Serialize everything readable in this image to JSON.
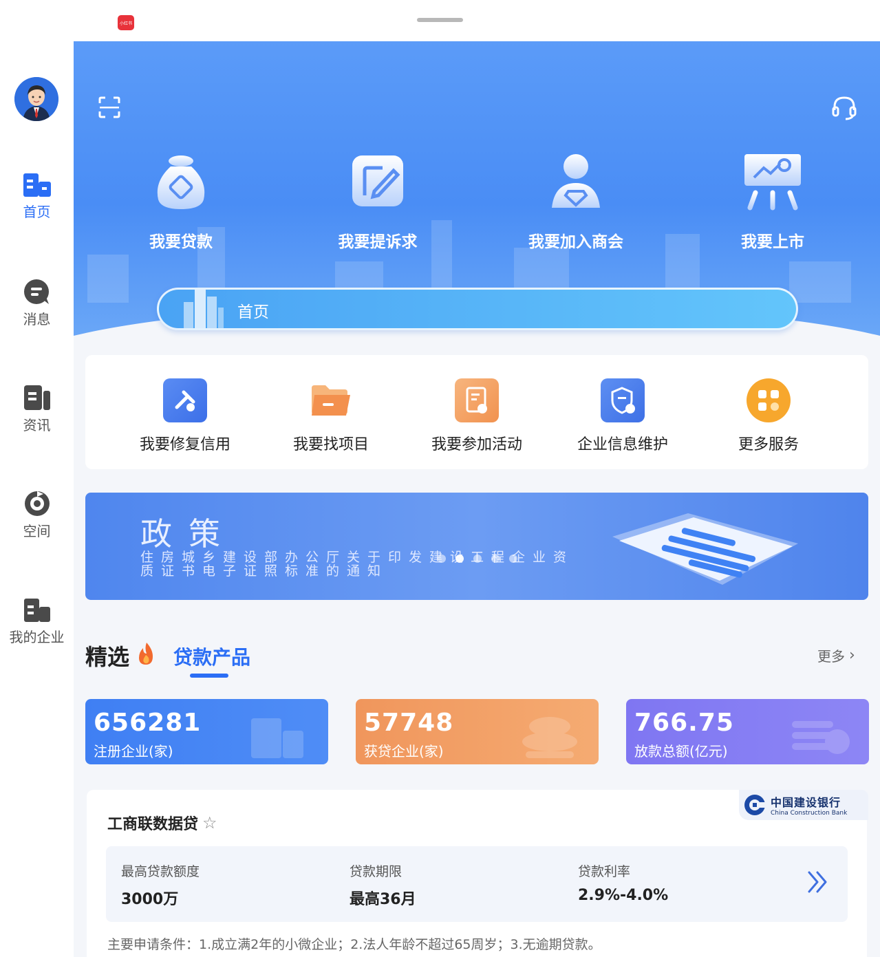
{
  "topbar": {
    "app_badge": "小红书"
  },
  "sidebar": {
    "items": [
      {
        "label": "首页",
        "icon": "home-building-icon",
        "active": true
      },
      {
        "label": "消息",
        "icon": "message-icon",
        "active": false
      },
      {
        "label": "资讯",
        "icon": "news-icon",
        "active": false
      },
      {
        "label": "空间",
        "icon": "space-icon",
        "active": false
      },
      {
        "label": "我的企业",
        "icon": "company-icon",
        "active": false
      }
    ]
  },
  "hero": {
    "quick_actions": [
      {
        "label": "我要贷款",
        "icon": "money-bag-icon"
      },
      {
        "label": "我要提诉求",
        "icon": "edit-note-icon"
      },
      {
        "label": "我要加入商会",
        "icon": "member-icon"
      },
      {
        "label": "我要上市",
        "icon": "presentation-board-icon"
      }
    ],
    "tab_label": "首页"
  },
  "services": [
    {
      "label": "我要修复信用",
      "icon": "repair-tools-icon",
      "color": "#4f7ff0"
    },
    {
      "label": "我要找项目",
      "icon": "folder-icon",
      "color": "#f39a5a"
    },
    {
      "label": "我要参加活动",
      "icon": "activity-doc-icon",
      "color": "#f4a46a"
    },
    {
      "label": "企业信息维护",
      "icon": "shield-company-icon",
      "color": "#4f84ee"
    },
    {
      "label": "更多服务",
      "icon": "grid-apps-icon",
      "color": "#f7a72d"
    }
  ],
  "banner": {
    "title": "政策",
    "subtitle": "住房城乡建设部办公厅关于印发建设工程企业资质证书电子证照标准的通知"
  },
  "featured": {
    "title": "精选",
    "tab": "贷款产品",
    "more": "更多"
  },
  "stats": [
    {
      "value": "656281",
      "caption": "注册企业(家)",
      "color": "#3f7ff3"
    },
    {
      "value": "57748",
      "caption": "获贷企业(家)",
      "color": "#f0965c"
    },
    {
      "value": "766.75",
      "caption": "放款总额(亿元)",
      "color": "#7f76f2"
    }
  ],
  "loan_card": {
    "bank_cn": "中国建设银行",
    "bank_en": "China Construction Bank",
    "name": "工商联数据贷",
    "max_amount_label": "最高贷款额度",
    "max_amount": "3000万",
    "term_label": "贷款期限",
    "term": "最高36月",
    "rate_label": "贷款利率",
    "rate": "2.9%-4.0%",
    "conditions": "主要申请条件：1.成立满2年的小微企业；2.法人年龄不超过65周岁；3.无逾期贷款。"
  }
}
